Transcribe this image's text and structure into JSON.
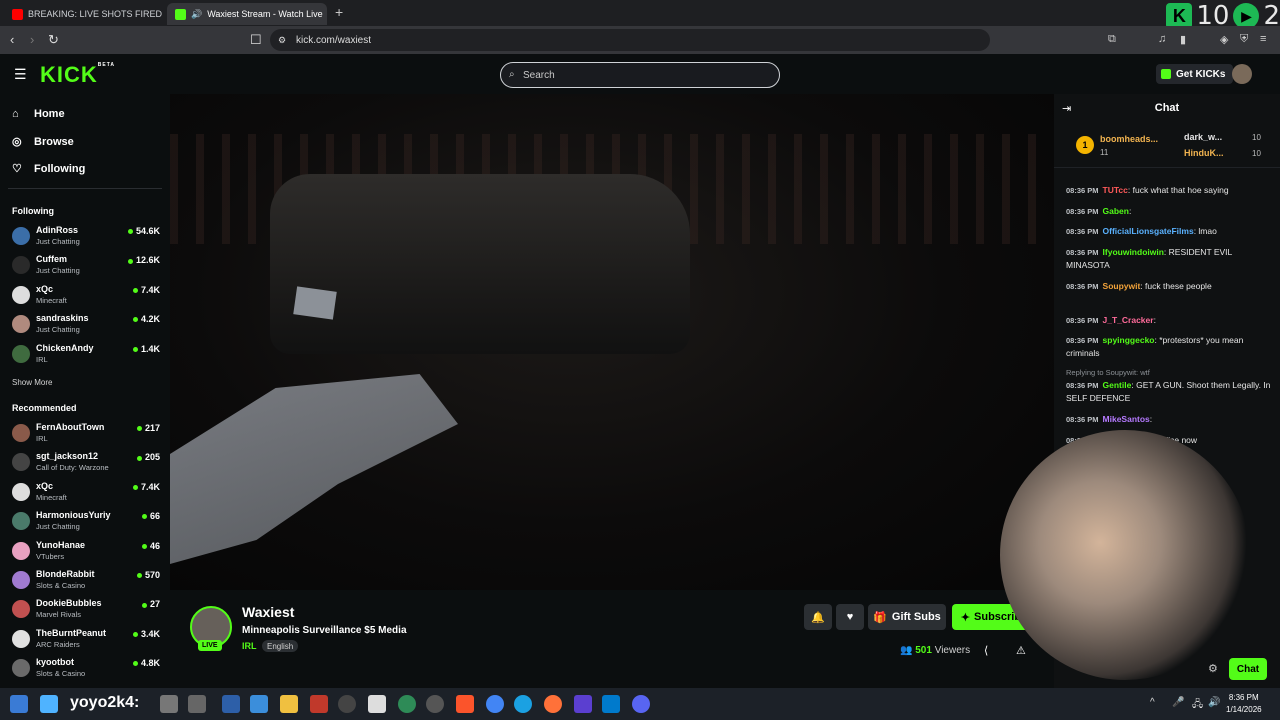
{
  "browser": {
    "tabs": [
      {
        "title": "BREAKING: LIVE SHOTS FIRED Amid"
      },
      {
        "title": "Waxiest Stream - Watch Live"
      }
    ],
    "url": "kick.com/waxiest",
    "overlay": {
      "left_number": "10",
      "right_number": "2"
    }
  },
  "header": {
    "logo": "KICK",
    "logo_tag": "BETA",
    "search_placeholder": "Search",
    "get_kicks": "Get KICKs"
  },
  "sidebar": {
    "nav": [
      {
        "label": "Home",
        "icon": "home-icon"
      },
      {
        "label": "Browse",
        "icon": "compass-icon"
      },
      {
        "label": "Following",
        "icon": "heart-icon"
      }
    ],
    "following_title": "Following",
    "following": [
      {
        "name": "AdinRoss",
        "category": "Just Chatting",
        "viewers": "54.6K",
        "color": "#3b6ea8"
      },
      {
        "name": "Cuffem",
        "category": "Just Chatting",
        "viewers": "12.6K",
        "color": "#2a2a2a"
      },
      {
        "name": "xQc",
        "category": "Minecraft",
        "viewers": "7.4K",
        "color": "#dddddd"
      },
      {
        "name": "sandraskins",
        "category": "Just Chatting",
        "viewers": "4.2K",
        "color": "#b08a7e"
      },
      {
        "name": "ChickenAndy",
        "category": "IRL",
        "viewers": "1.4K",
        "color": "#3f6b3f"
      }
    ],
    "show_more": "Show More",
    "recommended_title": "Recommended",
    "recommended": [
      {
        "name": "FernAboutTown",
        "category": "IRL",
        "viewers": "217",
        "color": "#8a5a4a"
      },
      {
        "name": "sgt_jackson12",
        "category": "Call of Duty: Warzone",
        "viewers": "205",
        "color": "#444444"
      },
      {
        "name": "xQc",
        "category": "Minecraft",
        "viewers": "7.4K",
        "color": "#dddddd"
      },
      {
        "name": "HarmoniousYuriy",
        "category": "Just Chatting",
        "viewers": "66",
        "color": "#4a7a6a"
      },
      {
        "name": "YunoHanae",
        "category": "VTubers",
        "viewers": "46",
        "color": "#e8a0c0"
      },
      {
        "name": "BlondeRabbit",
        "category": "Slots & Casino",
        "viewers": "570",
        "color": "#a07ad0"
      },
      {
        "name": "DookieBubbles",
        "category": "Marvel Rivals",
        "viewers": "27",
        "color": "#c05050"
      },
      {
        "name": "TheBurntPeanut",
        "category": "ARC Raiders",
        "viewers": "3.4K",
        "color": "#e0e0e0"
      },
      {
        "name": "kyootbot",
        "category": "Slots & Casino",
        "viewers": "4.8K",
        "color": "#6a6a6a"
      }
    ]
  },
  "stream": {
    "channel": "Waxiest",
    "title": "Minneapolis Surveillance $5 Media",
    "category": "IRL",
    "language": "English",
    "live": "LIVE",
    "gift_subs": "Gift Subs",
    "subscribe": "Subscribe",
    "viewers_count": "501",
    "viewers_label": "Viewers"
  },
  "chat": {
    "title": "Chat",
    "leaderboard": {
      "rank": "1",
      "first": {
        "name": "boomheads...",
        "value": "11"
      },
      "second": {
        "name": "dark_w...",
        "value": "10"
      },
      "third": {
        "name": "HinduK...",
        "value": "10"
      }
    },
    "messages": [
      {
        "time": "08:36 PM",
        "user": "TUTcc",
        "text": "fuck what that hoe saying",
        "color": "#ff5a5a"
      },
      {
        "time": "08:36 PM",
        "user": "Gaben",
        "text": "",
        "color": "#53fc18"
      },
      {
        "time": "08:36 PM",
        "user": "OfficialLionsgateFilms",
        "text": "lmao",
        "color": "#5ab2ff"
      },
      {
        "time": "08:36 PM",
        "user": "Ifyouwindoiwin",
        "text": "RESIDENT EVIL MINASOTA",
        "color": "#53fc18"
      },
      {
        "time": "08:36 PM",
        "user": "Soupywit",
        "text": "fuck these people",
        "color": "#f2a33a"
      },
      {
        "time": "08:36 PM",
        "user": "J_T_Cracker",
        "text": "",
        "color": "#ff6b9a"
      },
      {
        "time": "08:36 PM",
        "user": "spyinggecko",
        "text": "*protestors* you mean criminals",
        "color": "#53fc18"
      },
      {
        "time": "08:36 PM",
        "user": "Gentile",
        "text": "GET A GUN. Shoot them Legally. In SELF DEFENCE",
        "color": "#53fc18"
      },
      {
        "time": "08:36 PM",
        "user": "MikeSantos",
        "text": "",
        "color": "#b57aff"
      },
      {
        "time": "08:36 PM",
        "user": "",
        "text": "where are the police now",
        "color": "#cccccc"
      }
    ],
    "reply_note": "Replying to Soupywit: wtf",
    "chat_button": "Chat"
  },
  "taskbar": {
    "text": "yoyo2k4:",
    "time": "8:36 PM",
    "date": "1/14/2026"
  }
}
